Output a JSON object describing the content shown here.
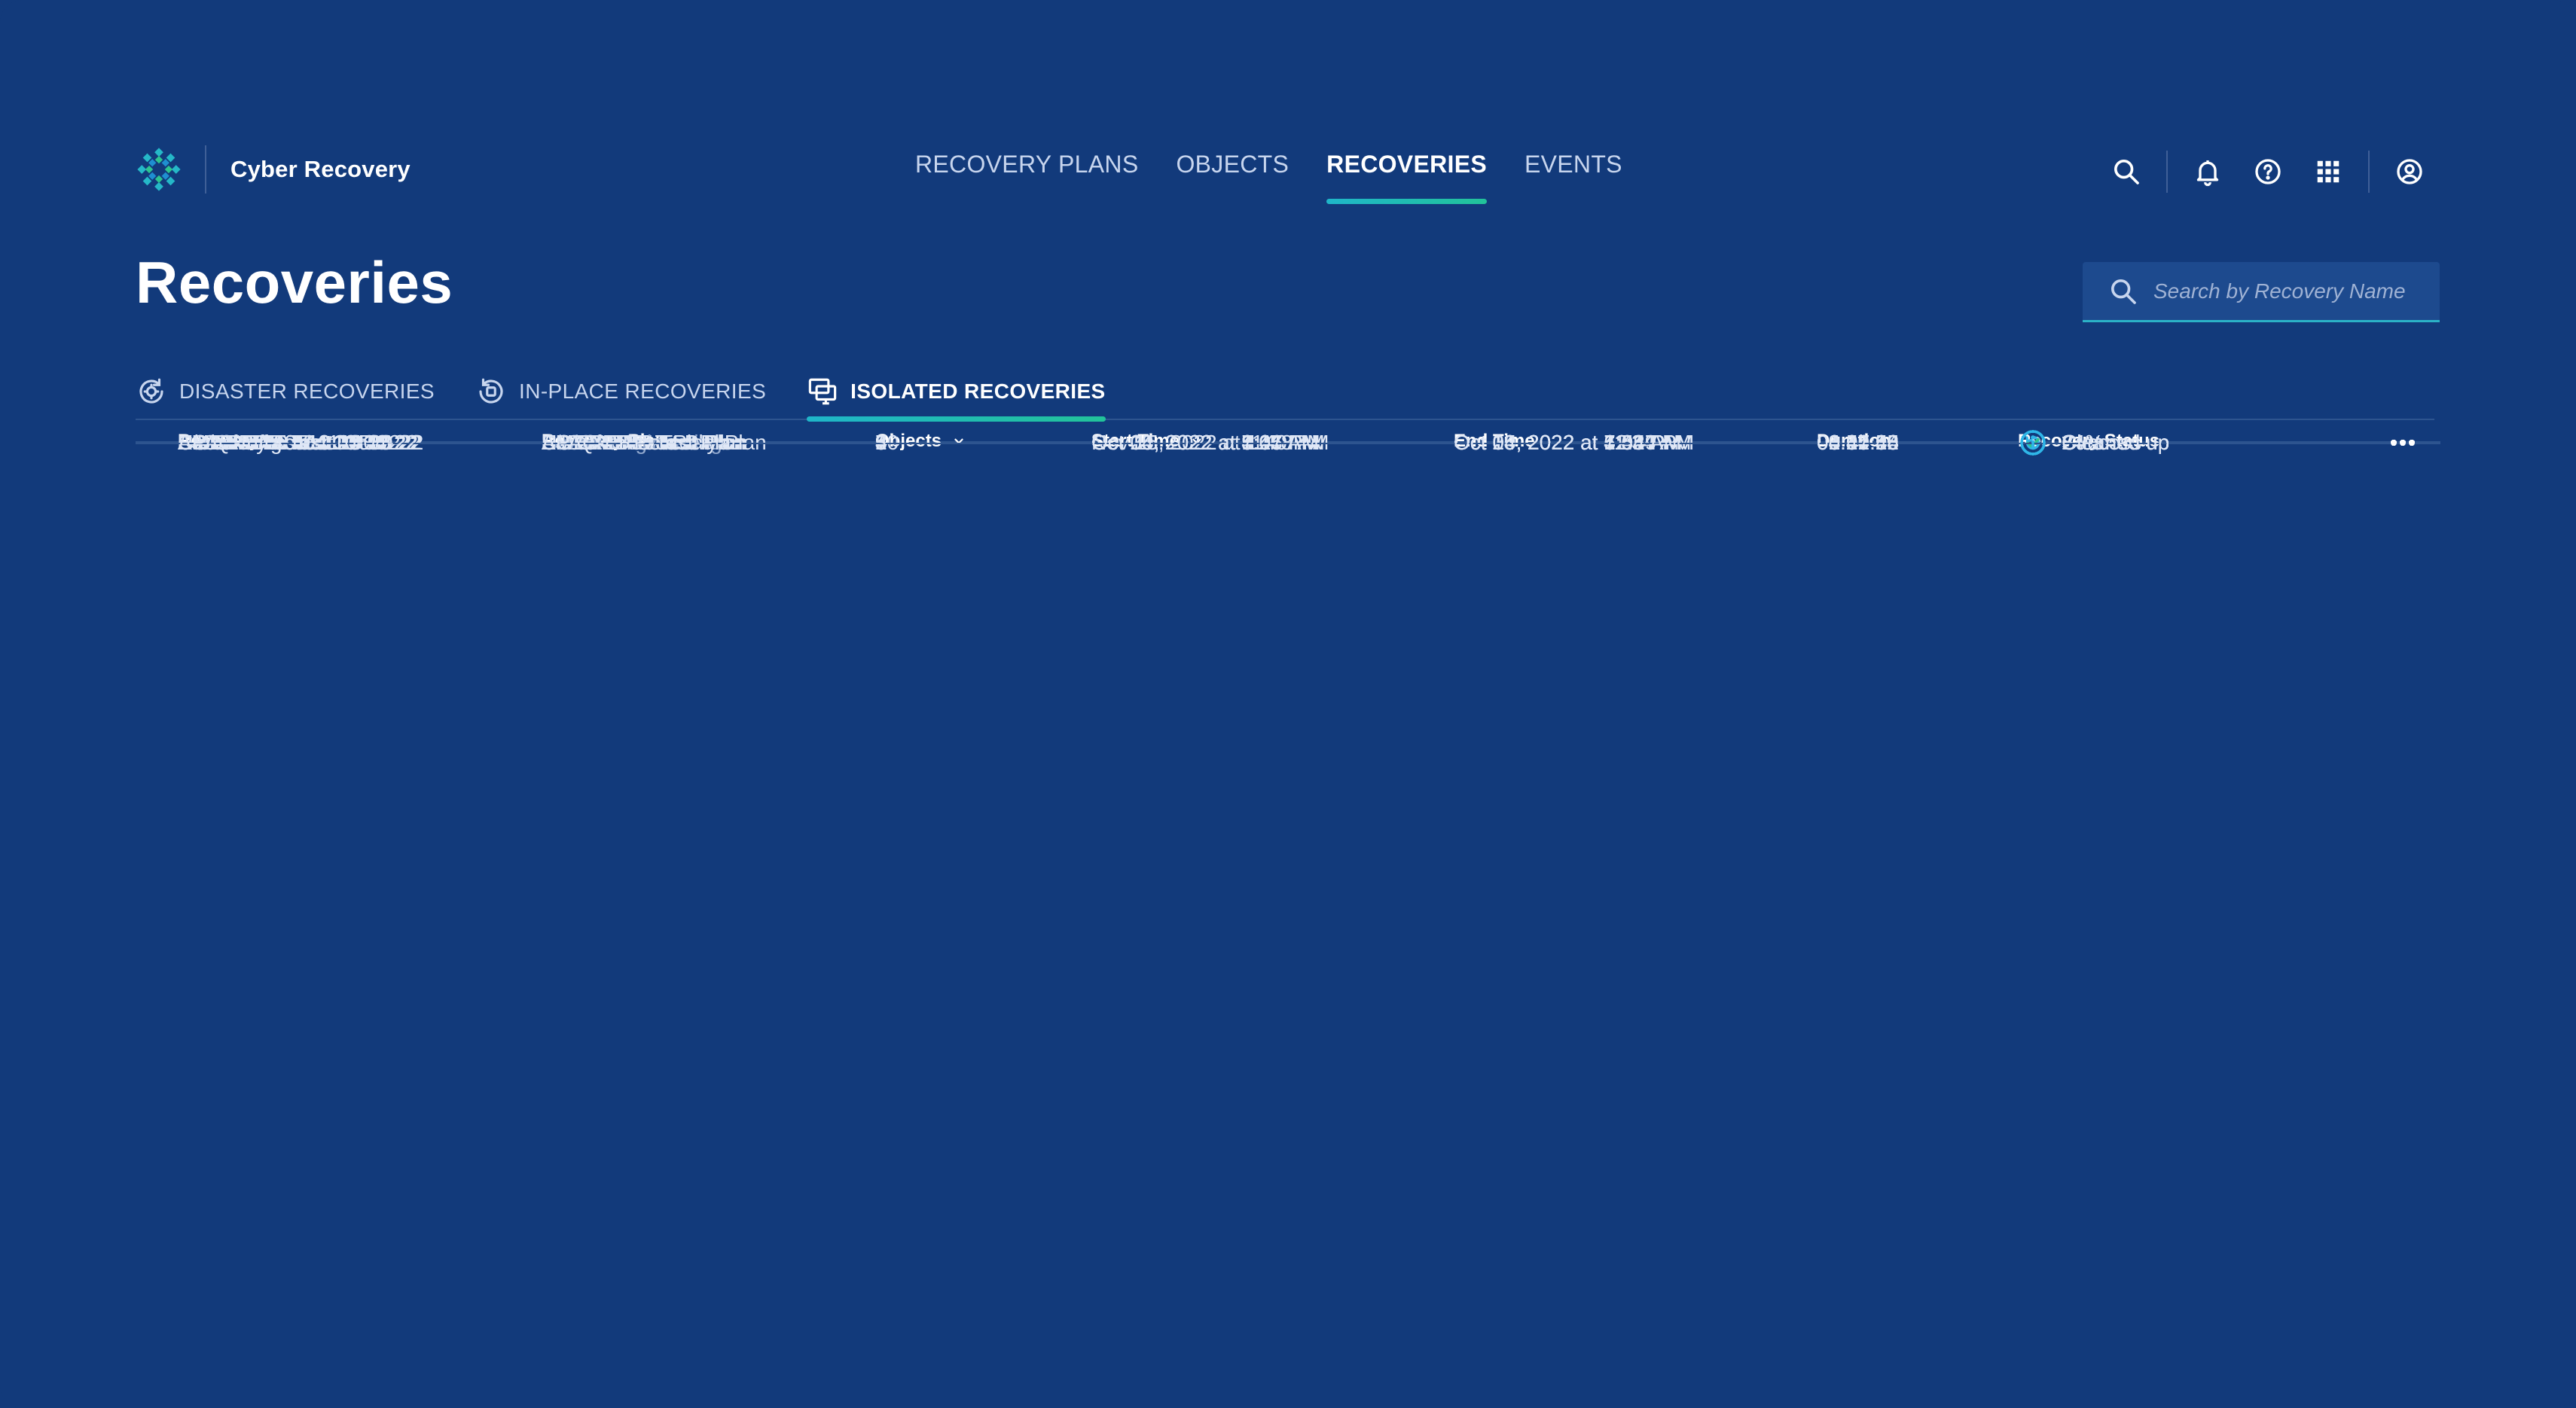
{
  "app": {
    "title": "Cyber Recovery"
  },
  "nav": {
    "items": [
      {
        "label": "RECOVERY PLANS",
        "active": false
      },
      {
        "label": "OBJECTS",
        "active": false
      },
      {
        "label": "RECOVERIES",
        "active": true
      },
      {
        "label": "EVENTS",
        "active": false
      }
    ]
  },
  "utility_icons": [
    "search-icon",
    "bell-icon",
    "help-icon",
    "apps-grid-icon",
    "user-account-icon"
  ],
  "page": {
    "title": "Recoveries"
  },
  "search": {
    "placeholder": "Search by Recovery Name",
    "value": ""
  },
  "subtabs": [
    {
      "label": "DISASTER RECOVERIES",
      "icon": "disaster-recovery-icon",
      "active": false
    },
    {
      "label": "IN-PLACE RECOVERIES",
      "icon": "in-place-recovery-icon",
      "active": false
    },
    {
      "label": "ISOLATED RECOVERIES",
      "icon": "isolated-recovery-icon",
      "active": true
    }
  ],
  "table": {
    "columns": {
      "recovery": "Recovery",
      "plan": "Recovery Plan",
      "objects": "Objects",
      "start": "Start Time",
      "end": "End Time",
      "duration": "Duration",
      "status": "Recovery Status"
    },
    "rows": [
      {
        "recovery": "SJC-ERP Test 11-15-22",
        "plan": "SJC-ERP-Test-Plan",
        "objects": "3",
        "start": "Nov 15, 2022 at 1:40 PM",
        "end": "-",
        "duration": "-",
        "status": "24%",
        "status_icon": "progress"
      },
      {
        "recovery": "US-ERP Test 10-25-22",
        "plan": "US-ERP-Recovery-Plan",
        "objects": "10",
        "start": "Oct 25, 2022 at 11:48 AM",
        "end": "Oct 25, 2022 at 4:08 PM",
        "duration": "04:20:56",
        "status": "Success",
        "status_icon": "success"
      },
      {
        "recovery": "Recovery 10-24",
        "plan": "-",
        "objects": "5",
        "start": "Oct 24, 2022 at 4:27 PM",
        "end": "Oct 24, 2022 at 5:41 PM",
        "duration": "01:14:34",
        "status": "Success",
        "status_icon": "success"
      },
      {
        "recovery": "Global Eng Test Oct",
        "plan": "Global-Engineering-...",
        "objects": "4",
        "start": "Oct 20, 2022 at 9:06 AM",
        "end": "Oct 20, 2022 at 12:59 PM",
        "duration": "03:32:25",
        "status": "Cleaned up",
        "status_icon": "info"
      },
      {
        "recovery": "EMEA-ERP Test 10-15-22",
        "plan": "EMEA-ERP-Test-Plan",
        "objects": "8",
        "start": "Oct 15, 2022 at 3:45 PM",
        "end": "Oct 15, 2022 at 6:54 PM",
        "duration": "03:09:25",
        "status": "Cleaned up",
        "status_icon": "info"
      },
      {
        "recovery": "US-Infra Test 10-14-22",
        "plan": "US-Infra-Test-Plan",
        "objects": "7",
        "start": "Oct 14, 2022 at 9:17 AM",
        "end": "Oct 14, 2022 at 11:34 AM",
        "duration": "02:17:48",
        "status": "Cleaned up",
        "status_icon": "info"
      },
      {
        "recovery": "APAC-ERP Test 10-10-22",
        "plan": "APAC-ERP-Test-Plan",
        "objects": "2",
        "start": "Oct 10, 2022 at 5:05 PM",
        "end": "Oct 10, 2022 at 6:02 PM",
        "duration": "00:57:12",
        "status": "Cleaned up",
        "status_icon": "info"
      },
      {
        "recovery": "US-QA-Dev Test 10-09-22",
        "plan": "US-QA-Dev-Test-Plan",
        "objects": "8",
        "start": "Oct 09, 2022 at 8:46 AM",
        "end": "Oct 09, 2022 at 12:47 PM",
        "duration": "04:01:42",
        "status": "Cleaned up",
        "status_icon": "info"
      },
      {
        "recovery": "EMEA-Infra Test 10-05-22",
        "plan": "EMEA-Infra-Test-Plan",
        "objects": "5",
        "start": "Oct 05, 2022 at 3:25 PM",
        "end": "Oct 05, 2022 at 4:54 PM",
        "duration": "01:29:09",
        "status": "Cleaned up",
        "status_icon": "info"
      },
      {
        "recovery": "APAC-Infra Test 10-04-22",
        "plan": "APAC-ERP-Test-Plan",
        "objects": "3",
        "start": "Oct 04, 2022 at 7:07 AM",
        "end": "Oct 04, 2022 at 7:54 AM",
        "duration": "00:47:46",
        "status": "Cleaned up",
        "status_icon": "info"
      }
    ]
  },
  "colors": {
    "background": "#123a7b",
    "row_alt": "#17468e",
    "accent_teal": "#1fb6c9",
    "success": "#2ec48f",
    "info": "#2fb6e8"
  }
}
